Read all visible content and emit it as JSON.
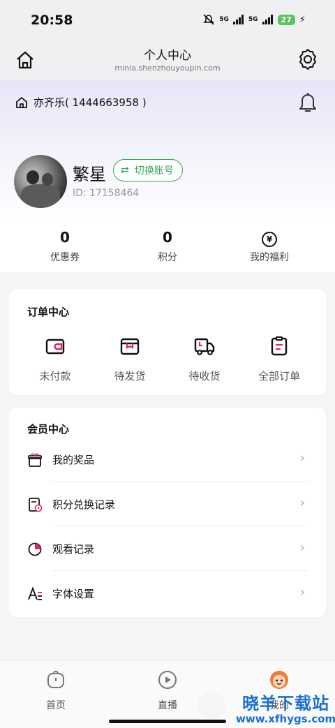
{
  "status_bar": {
    "time": "20:58",
    "signal_1": "5G",
    "signal_2": "5G",
    "battery": "27"
  },
  "header": {
    "title": "个人中心",
    "url": "minia.shenzhouyoupin.com"
  },
  "store": {
    "name": "亦齐乐( 1444663958 )"
  },
  "profile": {
    "username": "繁星",
    "switch_label": "切换账号",
    "user_id": "ID: 17158464"
  },
  "stats": [
    {
      "value": "0",
      "label": "优惠券"
    },
    {
      "value": "0",
      "label": "积分"
    },
    {
      "value": "",
      "label": "我的福利",
      "icon": "yen-icon"
    }
  ],
  "orders": {
    "title": "订单中心",
    "items": [
      {
        "label": "未付款",
        "icon": "wallet-icon"
      },
      {
        "label": "待发货",
        "icon": "box-icon"
      },
      {
        "label": "待收货",
        "icon": "truck-icon"
      },
      {
        "label": "全部订单",
        "icon": "clipboard-icon"
      }
    ]
  },
  "members": {
    "title": "会员中心",
    "items": [
      {
        "label": "我的奖品",
        "icon": "gift-icon"
      },
      {
        "label": "积分兑换记录",
        "icon": "exchange-record-icon"
      },
      {
        "label": "观看记录",
        "icon": "pie-chart-icon"
      },
      {
        "label": "字体设置",
        "icon": "font-icon"
      }
    ]
  },
  "tabbar": [
    {
      "label": "首页",
      "icon": "home-tab-icon"
    },
    {
      "label": "直播",
      "icon": "live-play-icon"
    },
    {
      "label": "我的",
      "icon": "profile-face-icon"
    }
  ],
  "watermark": {
    "brand": "晓羊下载站",
    "site": "www.xfhygs.com"
  },
  "colors": {
    "accent_green": "#3aa55a",
    "accent_red": "#e0245e",
    "battery_green": "#5ec25e"
  }
}
